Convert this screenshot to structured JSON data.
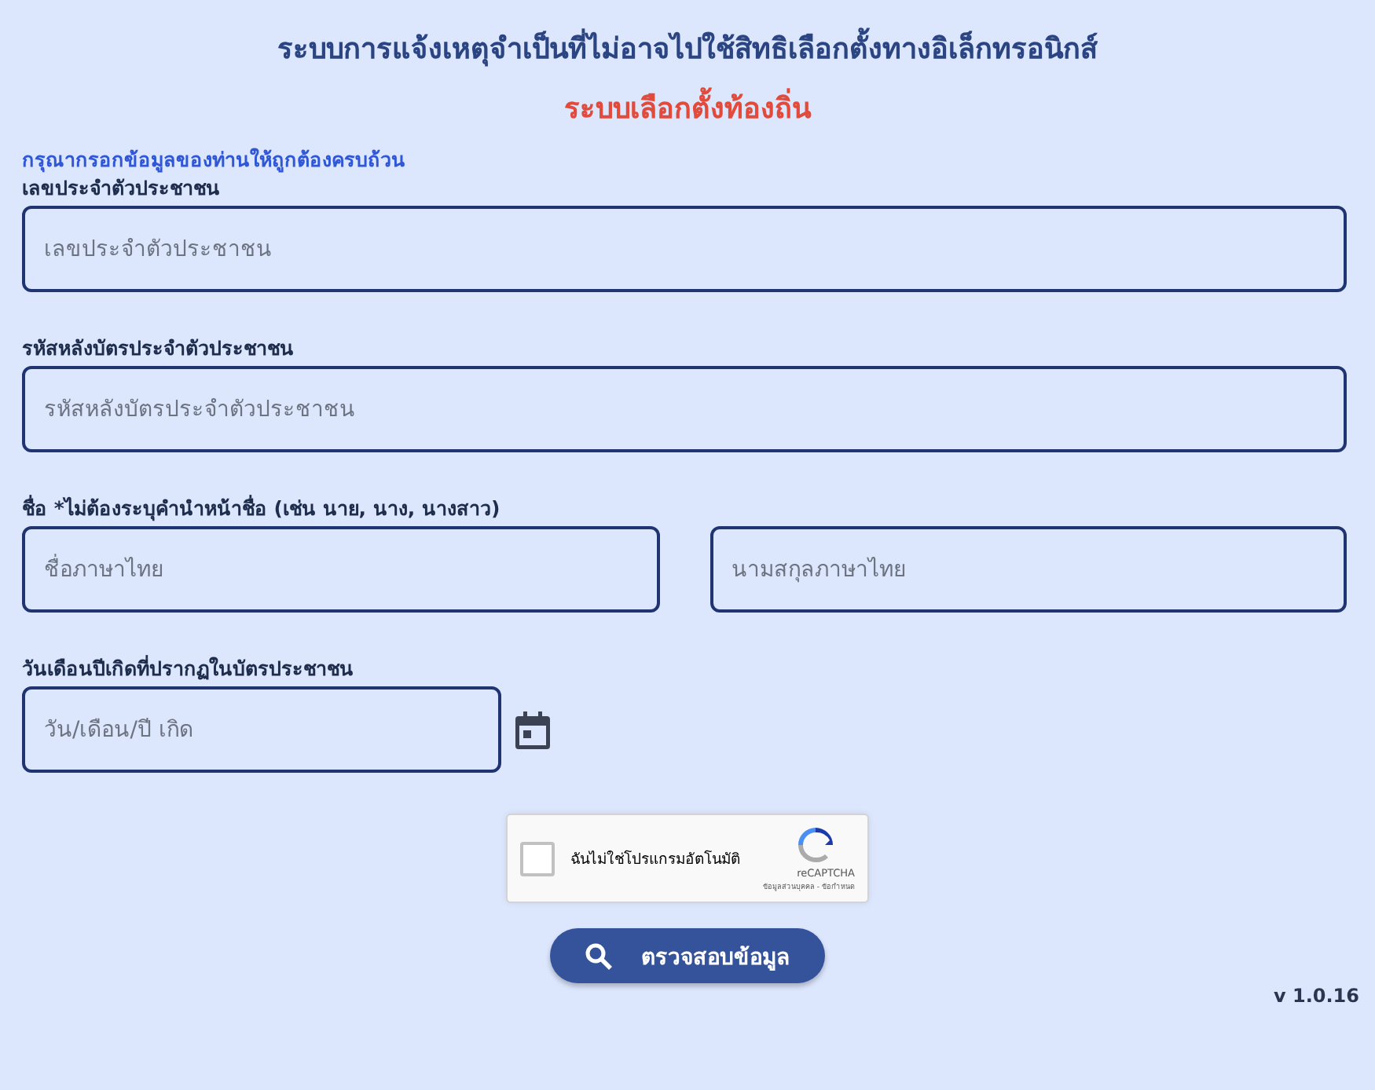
{
  "header": {
    "title": "ระบบการแจ้งเหตุจำเป็นที่ไม่อาจไปใช้สิทธิเลือกตั้งทางอิเล็กทรอนิกส์",
    "subtitle": "ระบบเลือกตั้งท้องถิ่น"
  },
  "instruction": "กรุณากรอกข้อมูลของท่านให้ถูกต้องครบถ้วน",
  "fields": [
    {
      "kind": "text",
      "label": "เลขประจำตัวประชาชน",
      "inputs": [
        {
          "placeholder": "เลขประจำตัวประชาชน"
        }
      ]
    },
    {
      "kind": "text",
      "label": "รหัสหลังบัตรประจำตัวประชาชน",
      "inputs": [
        {
          "placeholder": "รหัสหลังบัตรประจำตัวประชาชน"
        }
      ]
    },
    {
      "kind": "text",
      "label": "ชื่อ *ไม่ต้องระบุคำนำหน้าชื่อ (เช่น นาย, นาง, นางสาว)",
      "inputs": [
        {
          "placeholder": "ชื่อภาษาไทย"
        },
        {
          "placeholder": "นามสกุลภาษาไทย"
        }
      ]
    },
    {
      "kind": "date",
      "label": "วันเดือนปีเกิดที่ปรากฏในบัตรประชาชน",
      "inputs": [
        {
          "placeholder": "วัน/เดือน/ปี เกิด"
        }
      ]
    }
  ],
  "captcha": {
    "label": "ฉันไม่ใช่โปรแกรมอัตโนมัติ",
    "checked": false,
    "brand": "reCAPTCHA",
    "footer": "ข้อมูลส่วนบุคคล - ข้อกำหนด"
  },
  "submit_button": "ตรวจสอบข้อมูล",
  "version": "v 1.0.16"
}
